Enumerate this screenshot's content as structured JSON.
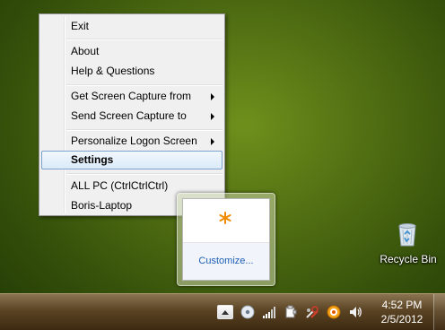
{
  "menu": {
    "items": [
      {
        "label": "Exit"
      },
      {
        "label": "About"
      },
      {
        "label": "Help & Questions"
      },
      {
        "label": "Get Screen Capture from"
      },
      {
        "label": "Send Screen Capture to"
      },
      {
        "label": "Personalize Logon Screen"
      },
      {
        "label": "Settings"
      },
      {
        "label": "ALL PC (CtrlCtrlCtrl)"
      },
      {
        "label": "Boris-Laptop"
      }
    ]
  },
  "tray_popup": {
    "customize_label": "Customize..."
  },
  "desktop": {
    "recycle_bin_label": "Recycle Bin"
  },
  "taskbar": {
    "time": "4:52 PM",
    "date": "2/5/2012"
  }
}
